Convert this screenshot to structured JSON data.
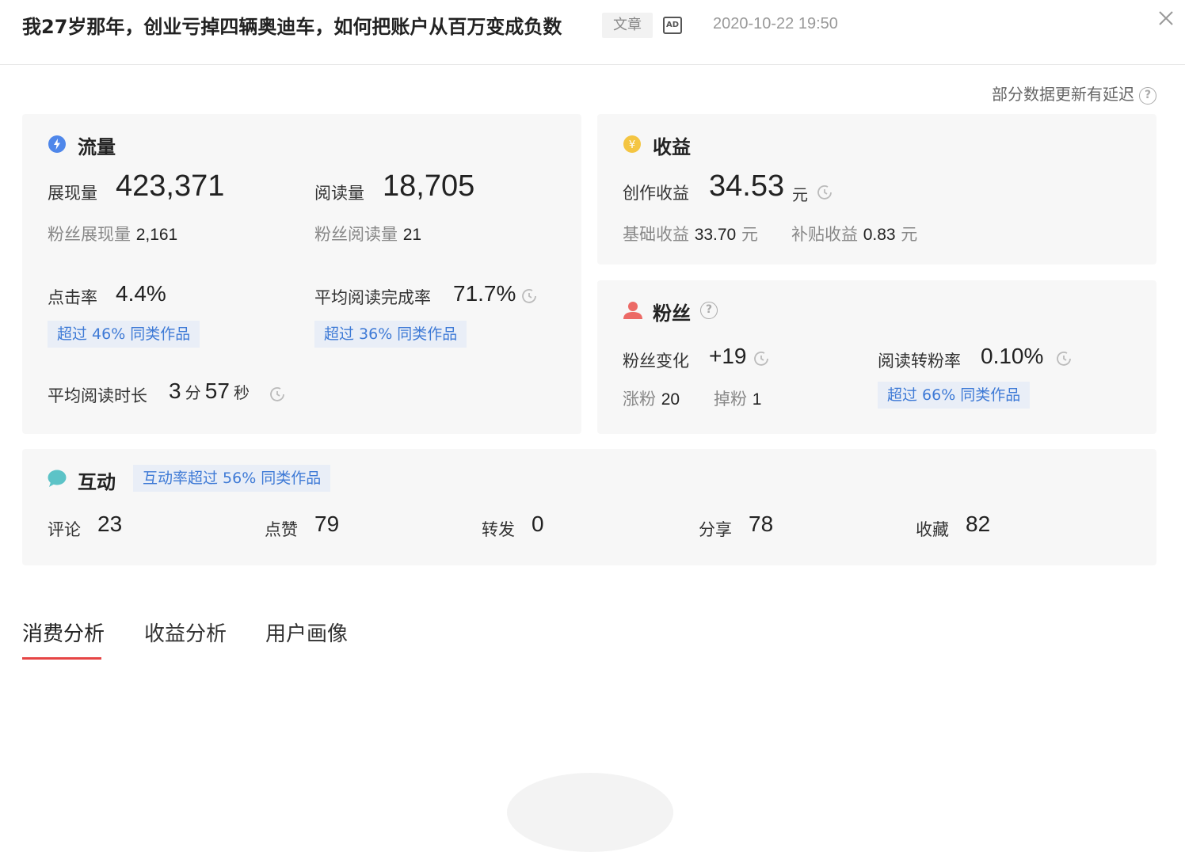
{
  "header": {
    "title": "我27岁那年，创业亏掉四辆奥迪车，如何把账户从百万变成负数",
    "type_tag": "文章",
    "ad_label": "AD",
    "publish_time": "2020-10-22 19:50"
  },
  "delay_note": "部分数据更新有延迟",
  "traffic": {
    "title": "流量",
    "impressions_label": "展现量",
    "impressions": "423,371",
    "reads_label": "阅读量",
    "reads": "18,705",
    "fan_impressions_label": "粉丝展现量",
    "fan_impressions": "2,161",
    "fan_reads_label": "粉丝阅读量",
    "fan_reads": "21",
    "ctr_label": "点击率",
    "ctr": "4.4%",
    "ctr_badge": "超过 46% 同类作品",
    "completion_label": "平均阅读完成率",
    "completion": "71.7%",
    "completion_badge": "超过 36% 同类作品",
    "avg_time_label": "平均阅读时长",
    "avg_time_min": "3",
    "min_unit": "分",
    "avg_time_sec": "57",
    "sec_unit": "秒"
  },
  "income": {
    "title": "收益",
    "creation_label": "创作收益",
    "creation": "34.53",
    "unit": "元",
    "base_label": "基础收益",
    "base": "33.70",
    "subsidy_label": "补贴收益",
    "subsidy": "0.83"
  },
  "fans": {
    "title": "粉丝",
    "change_label": "粉丝变化",
    "change": "+19",
    "conv_label": "阅读转粉率",
    "conv": "0.10%",
    "conv_badge": "超过 66% 同类作品",
    "gain_label": "涨粉",
    "gain": "20",
    "loss_label": "掉粉",
    "loss": "1"
  },
  "interaction": {
    "title": "互动",
    "badge": "互动率超过 56% 同类作品",
    "items": [
      {
        "label": "评论",
        "value": "23"
      },
      {
        "label": "点赞",
        "value": "79"
      },
      {
        "label": "转发",
        "value": "0"
      },
      {
        "label": "分享",
        "value": "78"
      },
      {
        "label": "收藏",
        "value": "82"
      }
    ]
  },
  "tabs": [
    {
      "label": "消费分析"
    },
    {
      "label": "收益分析"
    },
    {
      "label": "用户画像"
    }
  ],
  "colors": {
    "accent_red": "#e64545",
    "badge_blue": "#3e7ad6",
    "traffic_icon": "#4f87ea",
    "income_icon": "#f4c542",
    "fans_icon": "#ec6a66",
    "interaction_icon": "#5cc3c7"
  }
}
